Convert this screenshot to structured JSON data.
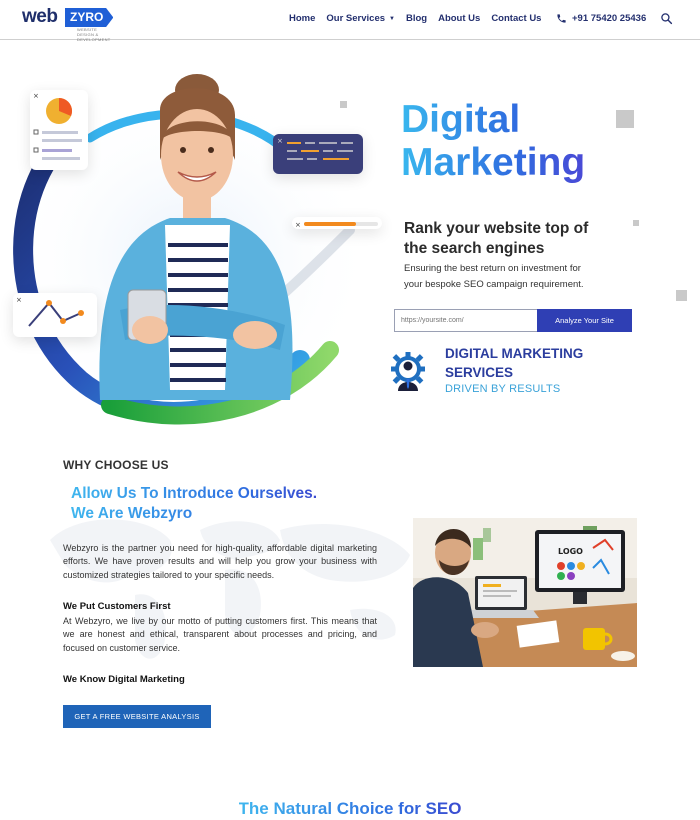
{
  "header": {
    "logo": {
      "part1": "web",
      "part2": "ZYRO",
      "tagline": "WEBSITE DESIGN & DEVELOPMENT"
    },
    "nav": [
      {
        "label": "Home"
      },
      {
        "label": "Our Services",
        "has_dropdown": true
      },
      {
        "label": "Blog"
      },
      {
        "label": "About Us"
      },
      {
        "label": "Contact Us"
      }
    ],
    "phone": "+91 75420 25436",
    "icons": {
      "phone": "phone-icon",
      "search": "search-icon",
      "dropdown": "caret-down-icon"
    }
  },
  "hero": {
    "title_line1": "Digital",
    "title_line2": "Marketing",
    "subtitle_line1": "Rank your website top of",
    "subtitle_line2": "the search engines",
    "description_line1": "Ensuring the best return on investment for",
    "description_line2": "your bespoke SEO campaign requirement.",
    "analyze": {
      "placeholder": "https://yoursite.com/",
      "button_label": "Analyze Your Site"
    },
    "services": {
      "title_line1": "DIGITAL MARKETING",
      "title_line2": "SERVICES",
      "tagline": "DRIVEN BY RESULTS",
      "icon": "gear-person-icon"
    }
  },
  "why": {
    "eyebrow": "WHY CHOOSE US",
    "heading_line1": "Allow Us To Introduce Ourselves.",
    "heading_line2": "We Are Webzyro",
    "intro": "Webzyro is the partner you need for high-quality, affordable digital marketing efforts. We have proven results and will help you grow your business with customized strategies tailored to your specific needs.",
    "point1_title": "We Put Customers First",
    "point1_text": "At Webzyro, we live by our motto of putting customers first. This means that we are honest and ethical, transparent about processes and pricing, and focused on customer service.",
    "point2_title": "We Know Digital Marketing",
    "cta_label": "GET A FREE WEBSITE ANALYSIS",
    "photo_screen_text": "LOGO"
  },
  "next_section": {
    "heading": "The Natural Choice for SEO"
  },
  "colors": {
    "brand_navy": "#24306f",
    "brand_blue": "#2f3fb4",
    "accent_cyan": "#39b7ee",
    "cta_blue": "#1f64b8"
  }
}
